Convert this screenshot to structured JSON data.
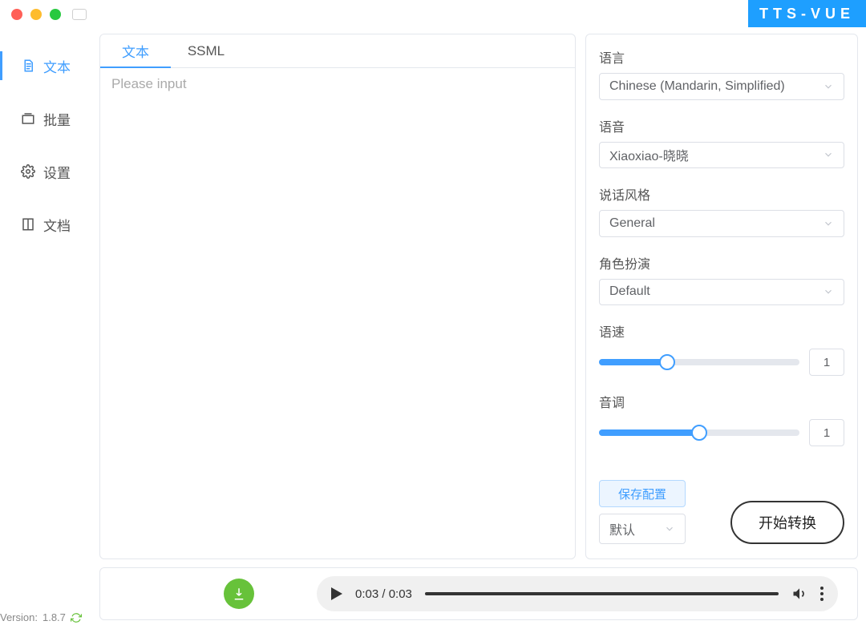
{
  "brand": "TTS-VUE",
  "sidebar": {
    "items": [
      {
        "label": "文本"
      },
      {
        "label": "批量"
      },
      {
        "label": "设置"
      },
      {
        "label": "文档"
      }
    ],
    "version_prefix": "Version:",
    "version": "1.8.7"
  },
  "editor": {
    "tabs": [
      {
        "label": "文本"
      },
      {
        "label": "SSML"
      }
    ],
    "placeholder": "Please input"
  },
  "panel": {
    "language_label": "语言",
    "language_value": "Chinese (Mandarin, Simplified)",
    "voice_label": "语音",
    "voice_value": "Xiaoxiao-晓晓",
    "style_label": "说话风格",
    "style_value": "General",
    "role_label": "角色扮演",
    "role_value": "Default",
    "speed_label": "语速",
    "speed_value": "1",
    "pitch_label": "音调",
    "pitch_value": "1",
    "save_config": "保存配置",
    "preset": "默认",
    "convert": "开始转换"
  },
  "player": {
    "time": "0:03 / 0:03"
  }
}
